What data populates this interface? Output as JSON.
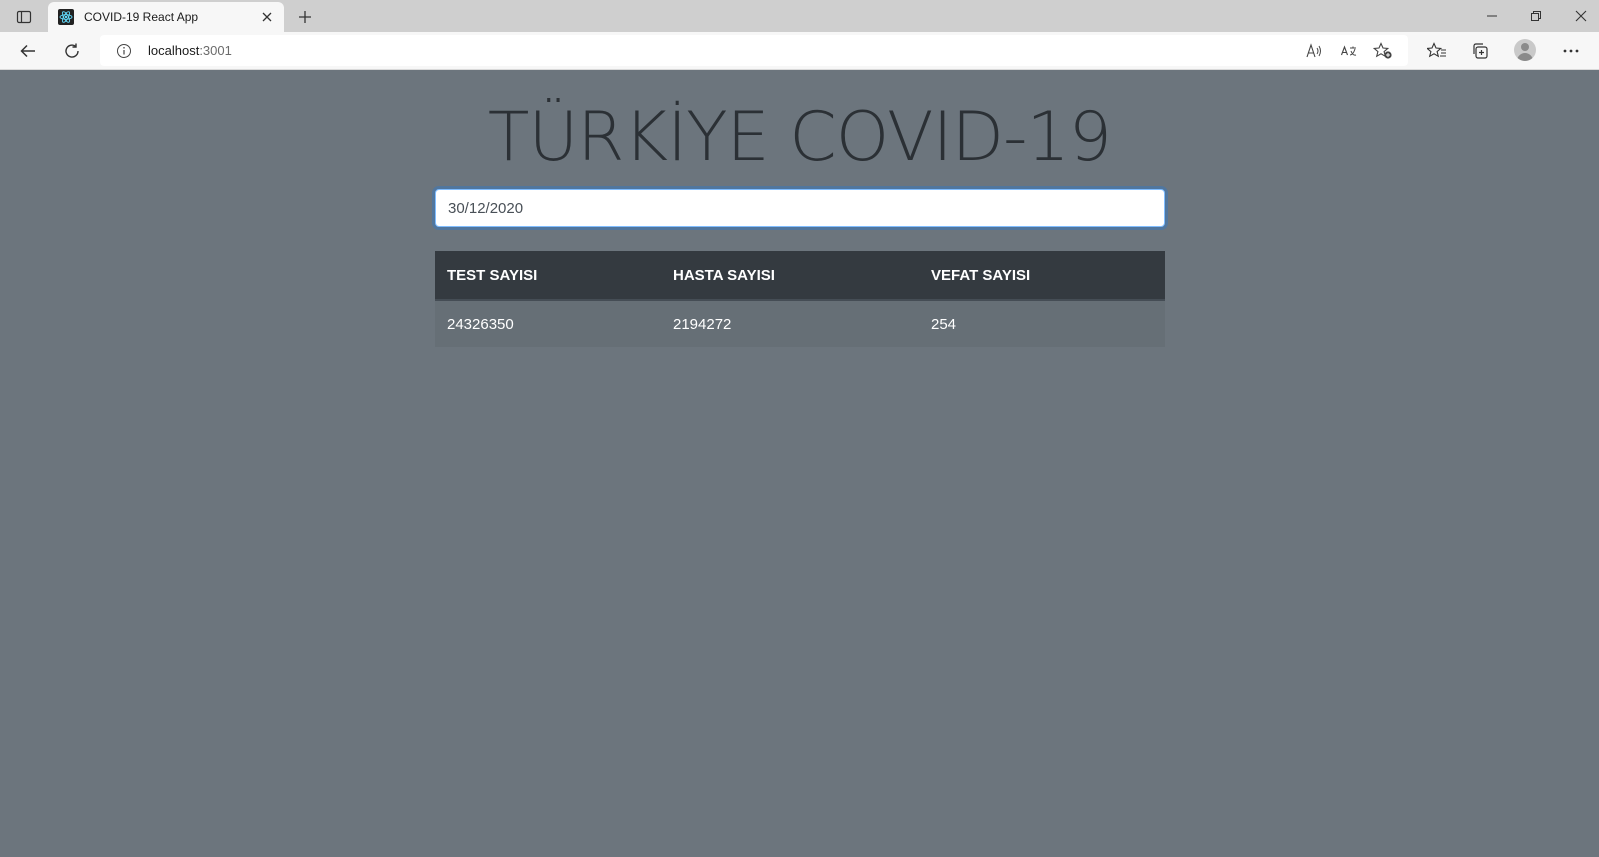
{
  "browser": {
    "tab_title": "COVID-19 React App",
    "url_host": "localhost",
    "url_port": ":3001",
    "icons": [
      "tab-actions-icon",
      "react-favicon-icon",
      "close-icon",
      "plus-icon",
      "minimize-icon",
      "restore-icon",
      "window-close-icon",
      "back-arrow-icon",
      "refresh-icon",
      "info-icon",
      "read-aloud-icon",
      "translate-icon",
      "add-favorite-icon",
      "favorites-icon",
      "collections-icon",
      "profile-avatar",
      "more-icon"
    ]
  },
  "page": {
    "title": "TÜRKİYE COVID-19",
    "date_input_value": "30/12/2020",
    "table": {
      "headers": [
        "TEST SAYISI",
        "HASTA SAYISI",
        "VEFAT SAYISI"
      ],
      "rows": [
        [
          "24326350",
          "2194272",
          "254"
        ]
      ]
    }
  },
  "colors": {
    "page_background": "#6c757d",
    "title": "#2b3035",
    "table_header": "#343a40",
    "input_focus": "#80bdff"
  }
}
